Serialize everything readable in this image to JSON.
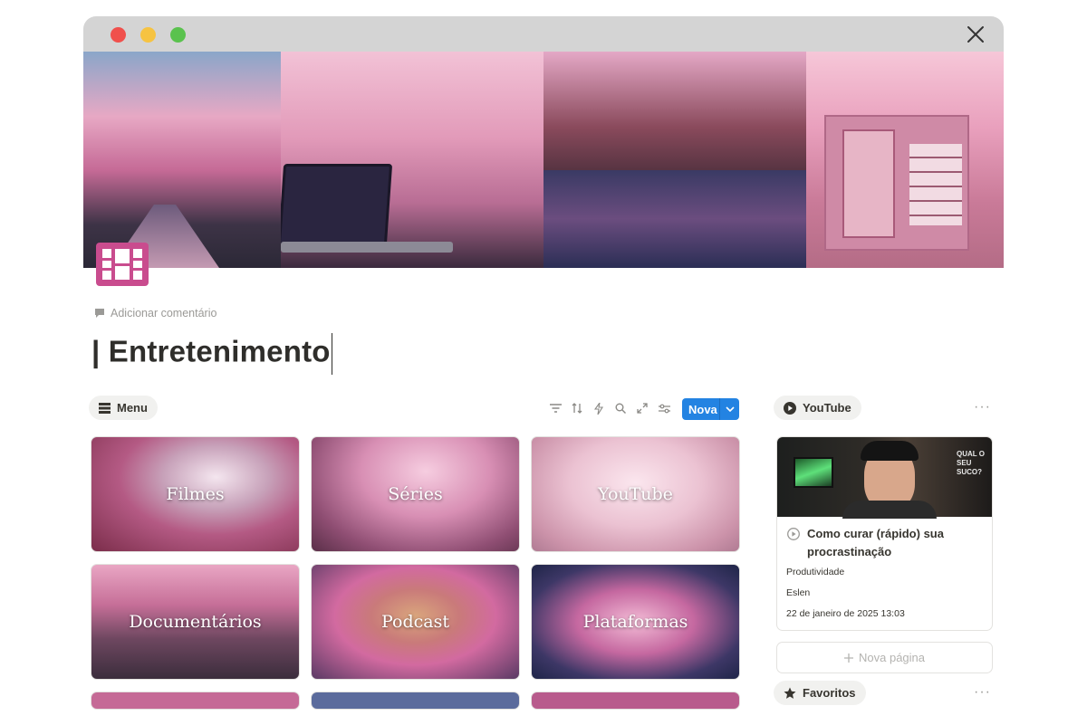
{
  "comment": {
    "label": "Adicionar comentário"
  },
  "page": {
    "title": "| Entretenimento"
  },
  "menu": {
    "label": "Menu"
  },
  "toolbar": {
    "new_label": "Nova"
  },
  "gallery": {
    "cards": [
      {
        "label": "Filmes"
      },
      {
        "label": "Séries"
      },
      {
        "label": "YouTube"
      },
      {
        "label": "Documentários"
      },
      {
        "label": "Podcast"
      },
      {
        "label": "Plataformas"
      }
    ]
  },
  "youtube": {
    "label": "YouTube",
    "video": {
      "title": "Como curar (rápido) sua procrastinação",
      "category": "Produtividade",
      "author": "Eslen",
      "date": "22 de janeiro de 2025 13:03",
      "thumb_text": "QUAL O SEU SUCO?"
    },
    "new_page": "Nova página"
  },
  "favorites": {
    "label": "Favoritos"
  },
  "colors": {
    "accent": "#2383e2",
    "icon": "#c94c8e"
  }
}
